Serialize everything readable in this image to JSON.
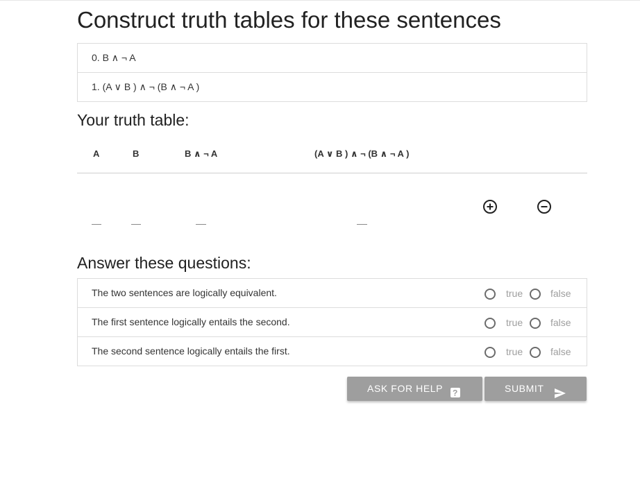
{
  "page": {
    "title": "Construct truth tables for these sentences"
  },
  "sentences": [
    {
      "label": "0. B ∧ ¬ A"
    },
    {
      "label": "1. (A ∨ B ) ∧ ¬ (B ∧ ¬ A )"
    }
  ],
  "truth_table": {
    "heading": "Your truth table:",
    "columns": [
      "A",
      "B",
      "B ∧ ¬ A",
      "(A ∨ B ) ∧ ¬ (B ∧ ¬ A )"
    ],
    "rows": [
      {
        "cells": [
          "",
          "",
          "",
          ""
        ]
      }
    ],
    "add_row_icon": "plus-circle-icon",
    "remove_row_icon": "minus-circle-icon"
  },
  "questions": {
    "heading": "Answer these questions:",
    "items": [
      {
        "text": "The two sentences are logically equivalent.",
        "true_label": "true",
        "false_label": "false",
        "selected": null
      },
      {
        "text": "The first sentence logically entails the second.",
        "true_label": "true",
        "false_label": "false",
        "selected": null
      },
      {
        "text": "The second sentence logically entails the first.",
        "true_label": "true",
        "false_label": "false",
        "selected": null
      }
    ]
  },
  "actions": {
    "help_label": "ASK FOR HELP",
    "help_icon": "question-mark-icon",
    "submit_label": "SUBMIT",
    "submit_icon": "send-icon"
  },
  "colors": {
    "button_bg": "#9e9e9e",
    "border": "#dcdcdc",
    "text": "#212121",
    "muted": "#9e9e9e"
  }
}
